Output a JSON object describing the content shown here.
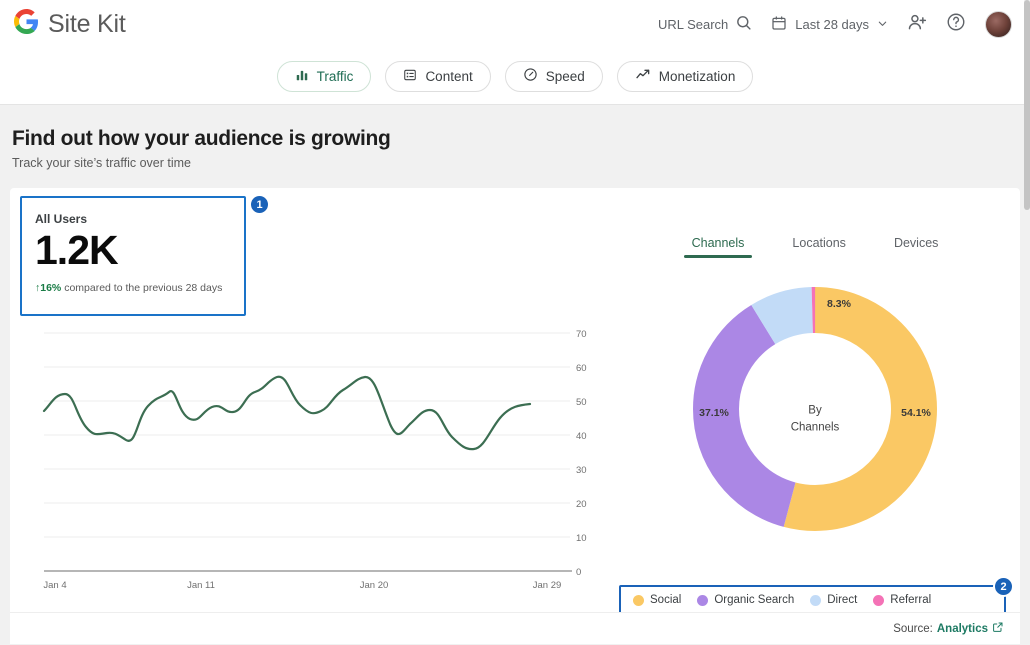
{
  "header": {
    "brand": "Site Kit",
    "logo_icon": "google-g-icon",
    "url_search_label": "URL Search",
    "search_icon": "search-icon",
    "calendar_icon": "calendar-icon",
    "date_range": "Last 28 days",
    "chevron_icon": "chevron-down-icon",
    "add_user_icon": "add-user-icon",
    "help_icon": "help-circle-icon",
    "avatar_icon": "user-avatar"
  },
  "tabs": [
    {
      "label": "Traffic",
      "icon": "bar-chart-icon",
      "active": true
    },
    {
      "label": "Content",
      "icon": "content-list-icon",
      "active": false
    },
    {
      "label": "Speed",
      "icon": "speedometer-icon",
      "active": false
    },
    {
      "label": "Monetization",
      "icon": "trend-up-icon",
      "active": false
    }
  ],
  "page": {
    "title": "Find out how your audience is growing",
    "subtitle": "Track your site’s traffic over time"
  },
  "metric": {
    "label": "All Users",
    "value": "1.2K",
    "delta_arrow": "↑",
    "delta": "16%",
    "delta_text": "compared to the previous 28 days",
    "badge": "1"
  },
  "breakdown": {
    "tabs": [
      {
        "label": "Channels",
        "active": true
      },
      {
        "label": "Locations",
        "active": false
      },
      {
        "label": "Devices",
        "active": false
      }
    ],
    "center_line1": "By",
    "center_line2": "Channels",
    "badge": "2"
  },
  "footer": {
    "source_prefix": "Source:",
    "source_link": "Analytics",
    "external_icon": "external-link-icon"
  },
  "colors": {
    "social": "#FAC864",
    "organic_search": "#AB87E5",
    "direct": "#C2DBF7",
    "referral": "#F472B6",
    "line": "#3C6E52",
    "accent_green": "#2E6A50",
    "annotation_blue": "#1A62B8"
  },
  "chart_data": [
    {
      "type": "line",
      "title": "All Users over time",
      "xlabel": "",
      "ylabel": "",
      "ylim": [
        0,
        70
      ],
      "yticks": [
        0,
        10,
        20,
        30,
        40,
        50,
        60,
        70
      ],
      "grid": true,
      "legend": "none",
      "xticks": [
        "Jan 4",
        "Jan 11",
        "Jan 20",
        "Jan 29"
      ],
      "xtick_positions": [
        0,
        7,
        16,
        25
      ],
      "x": [
        "Jan 4",
        "Jan 5",
        "Jan 6",
        "Jan 7",
        "Jan 8",
        "Jan 9",
        "Jan 10",
        "Jan 11",
        "Jan 12",
        "Jan 13",
        "Jan 14",
        "Jan 15",
        "Jan 16",
        "Jan 17",
        "Jan 18",
        "Jan 19",
        "Jan 20",
        "Jan 21",
        "Jan 22",
        "Jan 23",
        "Jan 24",
        "Jan 25",
        "Jan 26",
        "Jan 27",
        "Jan 28",
        "Jan 29"
      ],
      "values": [
        47,
        52,
        41,
        39,
        40,
        35,
        49,
        58,
        46,
        51,
        49,
        52,
        56,
        61,
        52,
        47,
        50,
        57,
        61,
        47,
        42,
        48,
        41,
        37,
        38,
        50
      ]
    },
    {
      "type": "pie",
      "title": "By Channels",
      "donut": true,
      "labels": [
        "Social",
        "Organic Search",
        "Direct",
        "Referral"
      ],
      "values": [
        54.1,
        37.1,
        8.3,
        0.5
      ],
      "value_labels": [
        "54.1%",
        "37.1%",
        "8.3%",
        ""
      ],
      "colors": [
        "#FAC864",
        "#AB87E5",
        "#C2DBF7",
        "#F472B6"
      ],
      "legend": "bottom"
    }
  ],
  "legend": [
    {
      "label": "Social",
      "color": "#FAC864"
    },
    {
      "label": "Organic Search",
      "color": "#AB87E5"
    },
    {
      "label": "Direct",
      "color": "#C2DBF7"
    },
    {
      "label": "Referral",
      "color": "#F472B6"
    }
  ]
}
